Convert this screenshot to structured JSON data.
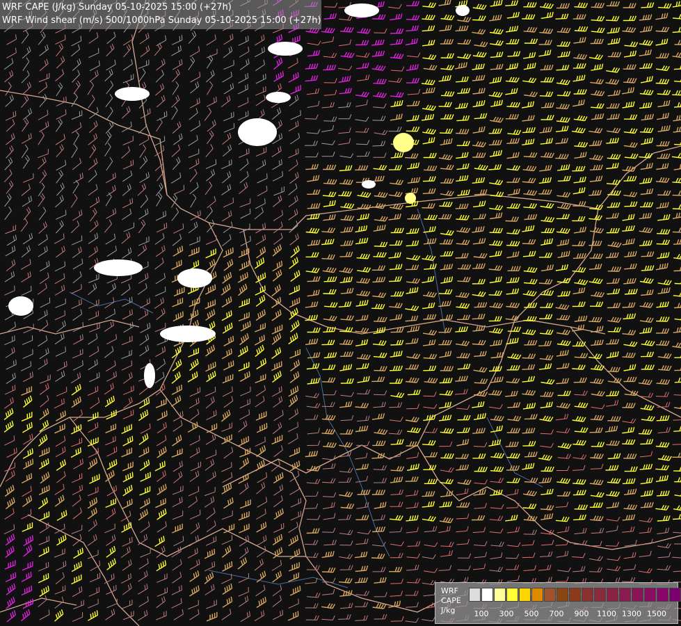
{
  "header": {
    "line1": "WRF CAPE (J/kg) Sunday 05-10-2025 15:00 (+27h)",
    "line2": "WRF Wind shear (m/s) 500/1000hPa Sunday 05-10-2025 15:00 (+27h)"
  },
  "legend": {
    "line1": "WRF",
    "line2": "CAPE",
    "line3": "J/kg",
    "colors": [
      "#dcdcdc",
      "#ffffff",
      "#ffff99",
      "#ffff33",
      "#ffd700",
      "#e08a00",
      "#a0522d",
      "#8b4513",
      "#8b3a1a",
      "#8b3030",
      "#8b2a3a",
      "#8b2244",
      "#8b1a4e",
      "#8b1458",
      "#8b0d62",
      "#8b066c",
      "#7a0070"
    ],
    "tick_labels": [
      "100",
      "300",
      "500",
      "700",
      "900",
      "1100",
      "1300",
      "1500"
    ]
  },
  "map": {
    "barb_colors": {
      "very_low": "#9e9e9e",
      "low": "#c08080",
      "moderate": "#e07070",
      "high": "#d9a860",
      "very_high": "#ffff33",
      "extreme": "#e020e0"
    },
    "border_color": "#d6a890",
    "river_color": "#4a6fa5"
  }
}
